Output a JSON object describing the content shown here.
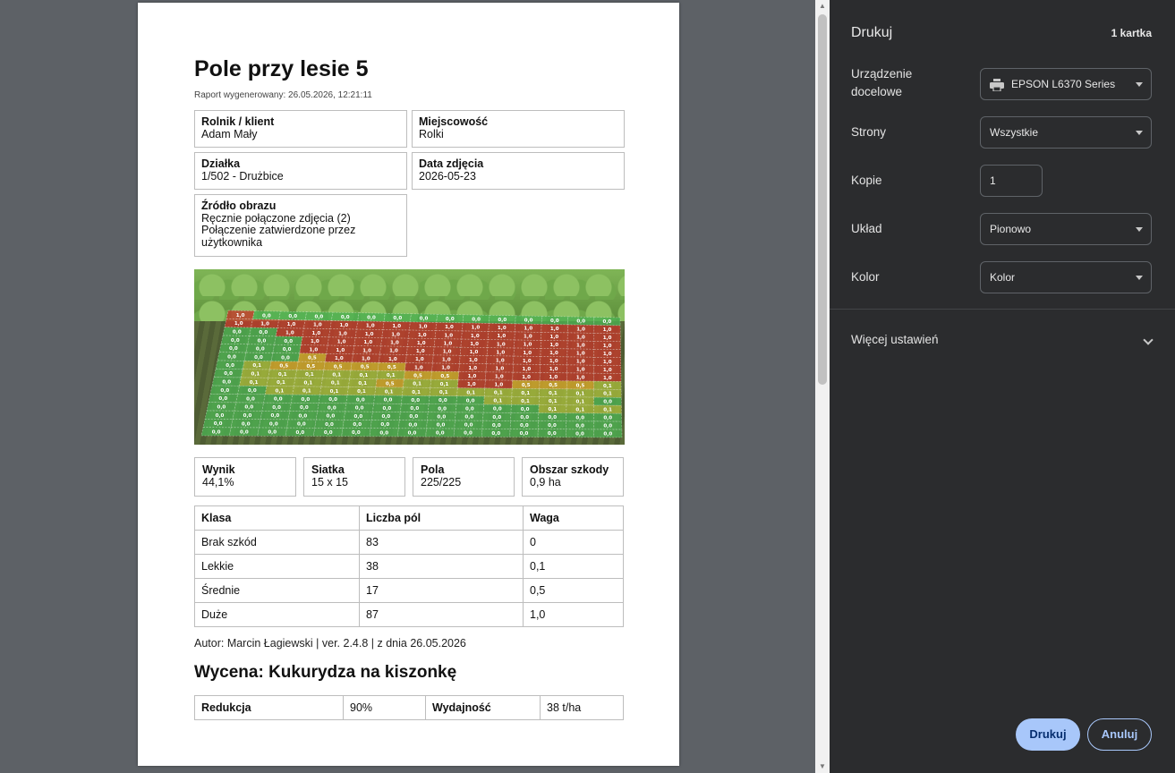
{
  "report": {
    "title": "Pole przy lesie 5",
    "generated": "Raport wygenerowany: 26.05.2026, 12:21:11",
    "info": [
      {
        "label": "Rolnik / klient",
        "value": "Adam Mały"
      },
      {
        "label": "Miejscowość",
        "value": "Rolki"
      },
      {
        "label": "Działka",
        "value": "1/502 - Drużbice"
      },
      {
        "label": "Data zdjęcia",
        "value": "2026-05-23"
      },
      {
        "label": "Źródło obrazu",
        "value": "Ręcznie połączone zdjęcia (2)",
        "value2": "Połączenie zatwierdzone przez użytkownika"
      }
    ],
    "stats": [
      {
        "label": "Wynik",
        "value": "44,1%"
      },
      {
        "label": "Siatka",
        "value": "15 x 15"
      },
      {
        "label": "Pola",
        "value": "225/225"
      },
      {
        "label": "Obszar szkody",
        "value": "0,9 ha"
      }
    ],
    "class_table": {
      "headers": [
        "Klasa",
        "Liczba pól",
        "Waga"
      ],
      "rows": [
        [
          "Brak szkód",
          "83",
          "0"
        ],
        [
          "Lekkie",
          "38",
          "0,1"
        ],
        [
          "Średnie",
          "17",
          "0,5"
        ],
        [
          "Duże",
          "87",
          "1,0"
        ]
      ]
    },
    "author": "Autor: Marcin Łagiewski | ver. 2.4.8 | z dnia 26.05.2026",
    "valuation_title": "Wycena: Kukurydza na kiszonkę",
    "valuation": {
      "reduction_label": "Redukcja",
      "reduction_value": "90%",
      "yield_label": "Wydajność",
      "yield_value": "38 t/ha"
    },
    "damage_grid": [
      [
        "1,0",
        "0,0",
        "0,0",
        "0,0",
        "0,0",
        "0,0",
        "0,0",
        "0,0",
        "0,0",
        "0,0",
        "0,0",
        "0,0",
        "0,0",
        "0,0",
        "0,0"
      ],
      [
        "1,0",
        "1,0",
        "1,0",
        "1,0",
        "1,0",
        "1,0",
        "1,0",
        "1,0",
        "1,0",
        "1,0",
        "1,0",
        "1,0",
        "1,0",
        "1,0",
        "1,0"
      ],
      [
        "0,0",
        "0,0",
        "1,0",
        "1,0",
        "1,0",
        "1,0",
        "1,0",
        "1,0",
        "1,0",
        "1,0",
        "1,0",
        "1,0",
        "1,0",
        "1,0",
        "1,0"
      ],
      [
        "0,0",
        "0,0",
        "0,0",
        "1,0",
        "1,0",
        "1,0",
        "1,0",
        "1,0",
        "1,0",
        "1,0",
        "1,0",
        "1,0",
        "1,0",
        "1,0",
        "1,0"
      ],
      [
        "0,0",
        "0,0",
        "0,0",
        "1,0",
        "1,0",
        "1,0",
        "1,0",
        "1,0",
        "1,0",
        "1,0",
        "1,0",
        "1,0",
        "1,0",
        "1,0",
        "1,0"
      ],
      [
        "0,0",
        "0,0",
        "0,0",
        "0,5",
        "1,0",
        "1,0",
        "1,0",
        "1,0",
        "1,0",
        "1,0",
        "1,0",
        "1,0",
        "1,0",
        "1,0",
        "1,0"
      ],
      [
        "0,0",
        "0,1",
        "0,5",
        "0,5",
        "0,5",
        "0,5",
        "0,5",
        "1,0",
        "1,0",
        "1,0",
        "1,0",
        "1,0",
        "1,0",
        "1,0",
        "1,0"
      ],
      [
        "0,0",
        "0,1",
        "0,1",
        "0,1",
        "0,1",
        "0,1",
        "0,1",
        "0,5",
        "0,5",
        "1,0",
        "1,0",
        "1,0",
        "1,0",
        "1,0",
        "1,0"
      ],
      [
        "0,0",
        "0,1",
        "0,1",
        "0,1",
        "0,1",
        "0,1",
        "0,5",
        "0,1",
        "0,1",
        "1,0",
        "1,0",
        "0,5",
        "0,5",
        "0,5",
        "0,1"
      ],
      [
        "0,0",
        "0,0",
        "0,1",
        "0,1",
        "0,1",
        "0,1",
        "0,1",
        "0,1",
        "0,1",
        "0,1",
        "0,1",
        "0,1",
        "0,1",
        "0,1",
        "0,1"
      ],
      [
        "0,0",
        "0,0",
        "0,0",
        "0,0",
        "0,0",
        "0,0",
        "0,0",
        "0,0",
        "0,0",
        "0,0",
        "0,1",
        "0,1",
        "0,1",
        "0,1",
        "0,0"
      ],
      [
        "0,0",
        "0,0",
        "0,0",
        "0,0",
        "0,0",
        "0,0",
        "0,0",
        "0,0",
        "0,0",
        "0,0",
        "0,0",
        "0,0",
        "0,1",
        "0,1",
        "0,1"
      ],
      [
        "0,0",
        "0,0",
        "0,0",
        "0,0",
        "0,0",
        "0,0",
        "0,0",
        "0,0",
        "0,0",
        "0,0",
        "0,0",
        "0,0",
        "0,0",
        "0,0",
        "0,0"
      ],
      [
        "0,0",
        "0,0",
        "0,0",
        "0,0",
        "0,0",
        "0,0",
        "0,0",
        "0,0",
        "0,0",
        "0,0",
        "0,0",
        "0,0",
        "0,0",
        "0,0",
        "0,0"
      ],
      [
        "0,0",
        "0,0",
        "0,0",
        "0,0",
        "0,0",
        "0,0",
        "0,0",
        "0,0",
        "0,0",
        "0,0",
        "0,0",
        "0,0",
        "0,0",
        "0,0",
        "0,0"
      ]
    ],
    "damage_colors": {
      "0,0": "#4caf50",
      "0,1": "#a5b83a",
      "0,5": "#d4a62a",
      "1,0": "#c0392b"
    }
  },
  "print_panel": {
    "title": "Drukuj",
    "sheet_count": "1 kartka",
    "destination_label": "Urządzenie docelowe",
    "destination_value": "EPSON L6370 Series",
    "pages_label": "Strony",
    "pages_value": "Wszystkie",
    "copies_label": "Kopie",
    "copies_value": "1",
    "layout_label": "Układ",
    "layout_value": "Pionowo",
    "color_label": "Kolor",
    "color_value": "Kolor",
    "more_settings": "Więcej ustawień",
    "print_button": "Drukuj",
    "cancel_button": "Anuluj"
  }
}
